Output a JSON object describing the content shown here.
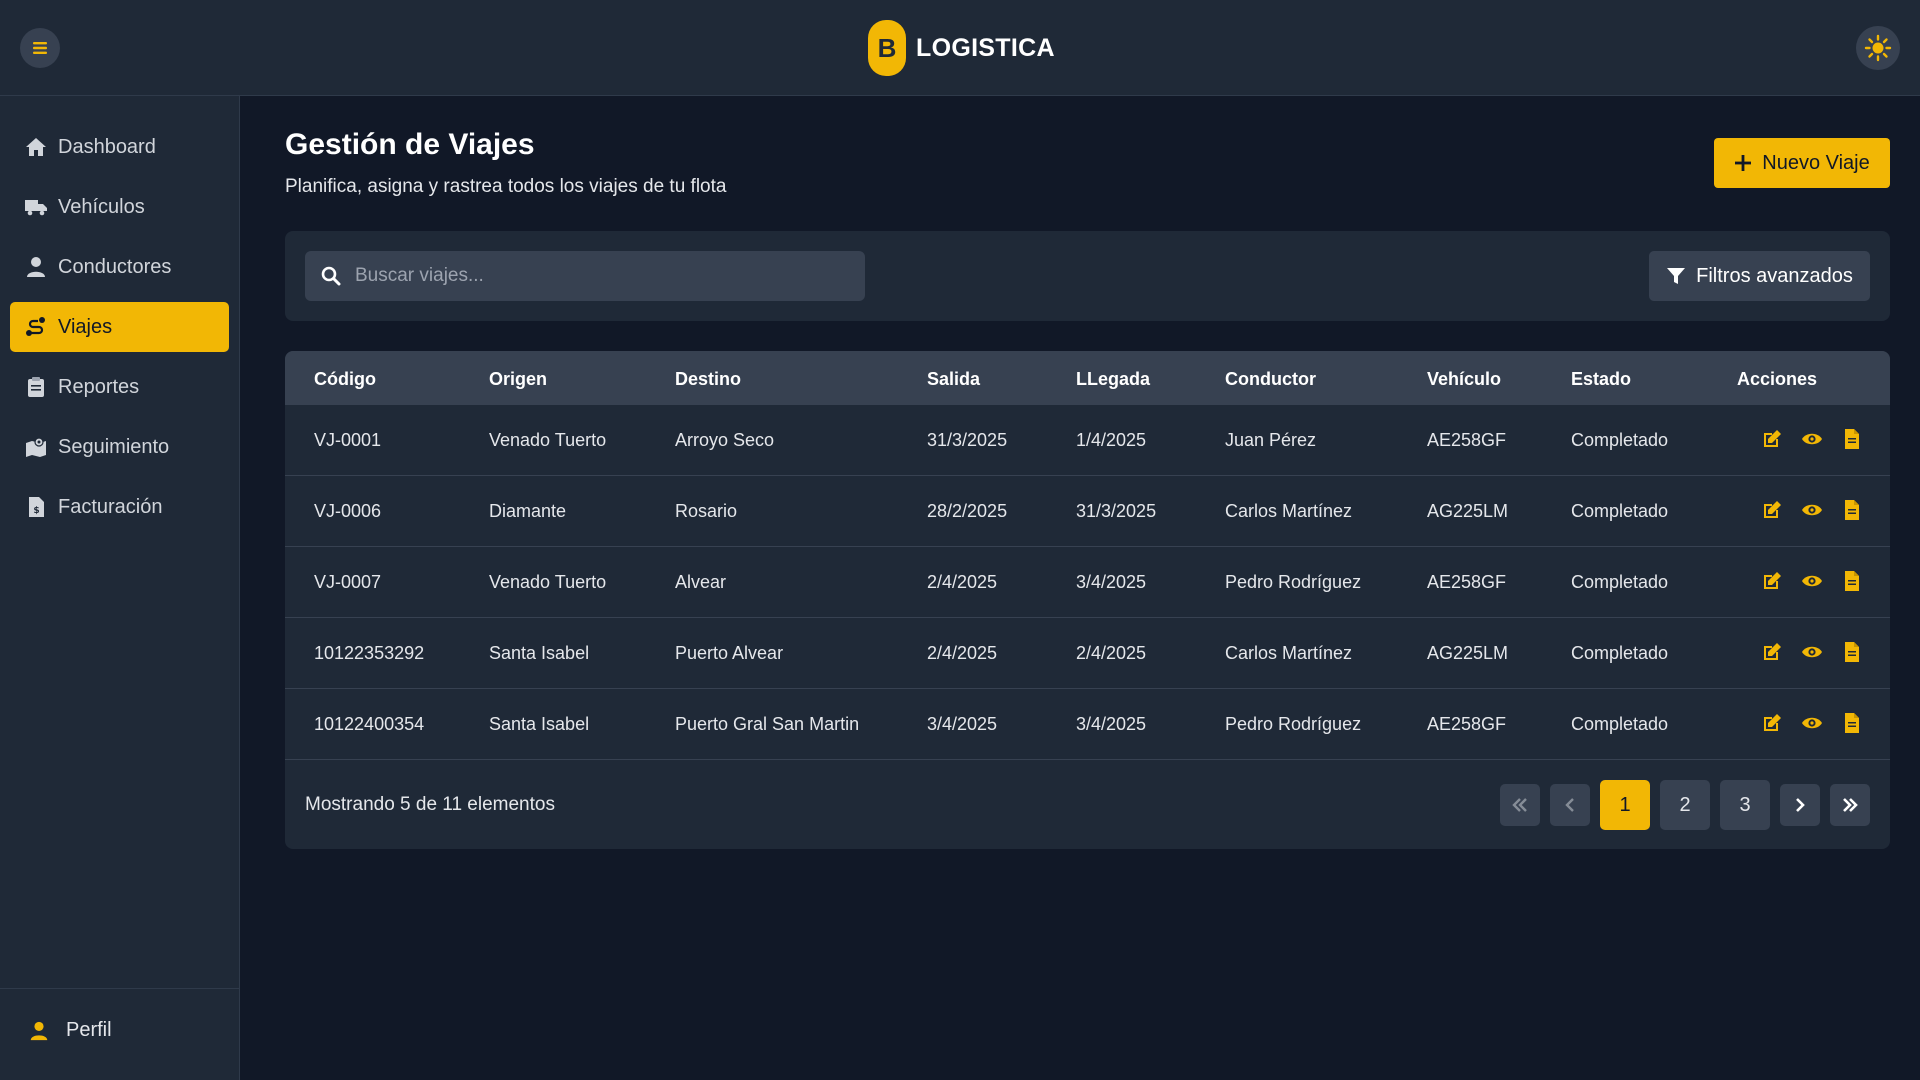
{
  "brand": {
    "logo_letter": "B",
    "name": "LOGISTICA",
    "accent": "#f2b705"
  },
  "sidebar": {
    "items": [
      {
        "label": "Dashboard",
        "icon": "home-icon"
      },
      {
        "label": "Vehículos",
        "icon": "truck-icon"
      },
      {
        "label": "Conductores",
        "icon": "user-icon"
      },
      {
        "label": "Viajes",
        "icon": "route-icon",
        "active": true
      },
      {
        "label": "Reportes",
        "icon": "clipboard-icon"
      },
      {
        "label": "Seguimiento",
        "icon": "map-location-icon"
      },
      {
        "label": "Facturación",
        "icon": "invoice-icon"
      }
    ],
    "profile_label": "Perfil"
  },
  "page": {
    "title": "Gestión de Viajes",
    "subtitle": "Planifica, asigna y rastrea todos los viajes de tu flota",
    "new_button": "Nuevo Viaje"
  },
  "search": {
    "placeholder": "Buscar viajes...",
    "value": ""
  },
  "filters_button": "Filtros avanzados",
  "table": {
    "headers": [
      "Código",
      "Origen",
      "Destino",
      "Salida",
      "LLegada",
      "Conductor",
      "Vehículo",
      "Estado",
      "Acciones"
    ],
    "rows": [
      [
        "VJ-0001",
        "Venado Tuerto",
        "Arroyo Seco",
        "31/3/2025",
        "1/4/2025",
        "Juan Pérez",
        "AE258GF",
        "Completado"
      ],
      [
        "VJ-0006",
        "Diamante",
        "Rosario",
        "28/2/2025",
        "31/3/2025",
        "Carlos Martínez",
        "AG225LM",
        "Completado"
      ],
      [
        "VJ-0007",
        "Venado Tuerto",
        "Alvear",
        "2/4/2025",
        "3/4/2025",
        "Pedro Rodríguez",
        "AE258GF",
        "Completado"
      ],
      [
        "10122353292",
        "Santa Isabel",
        "Puerto Alvear",
        "2/4/2025",
        "2/4/2025",
        "Carlos Martínez",
        "AG225LM",
        "Completado"
      ],
      [
        "10122400354",
        "Santa Isabel",
        "Puerto Gral San Martin",
        "3/4/2025",
        "3/4/2025",
        "Pedro Rodríguez",
        "AE258GF",
        "Completado"
      ]
    ],
    "row_actions": [
      "edit-icon",
      "eye-icon",
      "file-icon"
    ]
  },
  "pagination": {
    "summary": "Mostrando 5 de 11 elementos",
    "pages": [
      "1",
      "2",
      "3"
    ],
    "current": "1"
  }
}
